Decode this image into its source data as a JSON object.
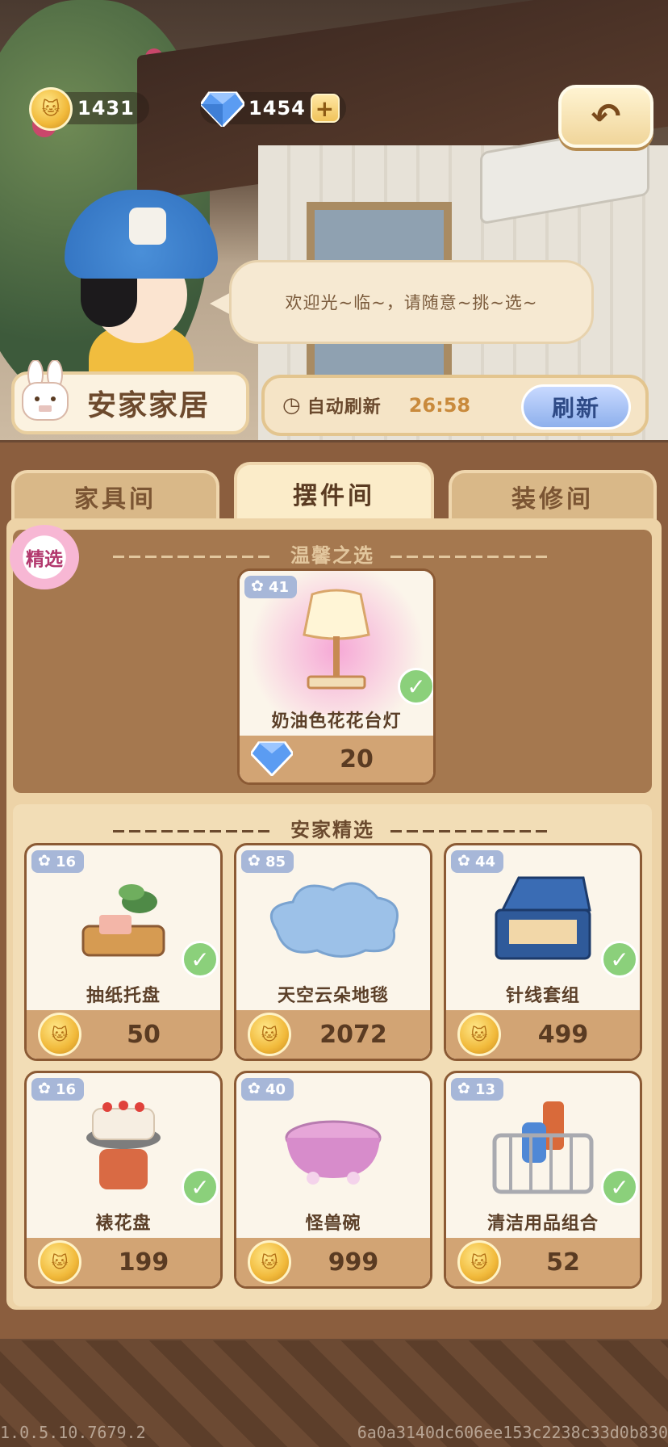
{
  "currency": {
    "coins": "1431",
    "gems": "1454",
    "add_label": "+"
  },
  "back_icon": "back-arrow-icon",
  "npc": {
    "dialog": "欢迎光~临~，请随意~挑~选~"
  },
  "shop": {
    "name": "安家家居",
    "auto_refresh_label": "自动刷新",
    "timer": "26:58",
    "refresh_button": "刷新"
  },
  "tabs": [
    {
      "label": "家具间",
      "active": false
    },
    {
      "label": "摆件间",
      "active": true
    },
    {
      "label": "装修间",
      "active": false
    }
  ],
  "featured": {
    "badge": "精选",
    "title": "温馨之选",
    "item": {
      "level": "41",
      "name": "奶油色花花台灯",
      "price": "20",
      "currency": "gem",
      "owned": true
    }
  },
  "picks": {
    "title": "安家精选",
    "items": [
      {
        "level": "16",
        "name": "抽纸托盘",
        "price": "50",
        "owned": true
      },
      {
        "level": "85",
        "name": "天空云朵地毯",
        "price": "2072",
        "owned": false
      },
      {
        "level": "44",
        "name": "针线套组",
        "price": "499",
        "owned": true
      },
      {
        "level": "16",
        "name": "裱花盘",
        "price": "199",
        "owned": true
      },
      {
        "level": "40",
        "name": "怪兽碗",
        "price": "999",
        "owned": false
      },
      {
        "level": "13",
        "name": "清洁用品组合",
        "price": "52",
        "owned": true
      }
    ]
  },
  "footer": {
    "version": "1.0.5.10.7679.2",
    "hash": "6a0a3140dc606ee153c2238c33d0b830"
  },
  "colors": {
    "panel_brown": "#8b5e3e",
    "tab_active": "#fbecc9",
    "level_badge": "#a7b7d8",
    "check_green": "#8bd07b",
    "coin_gold": "#f1b93a",
    "refresh_blue": "#8eb0ec"
  }
}
